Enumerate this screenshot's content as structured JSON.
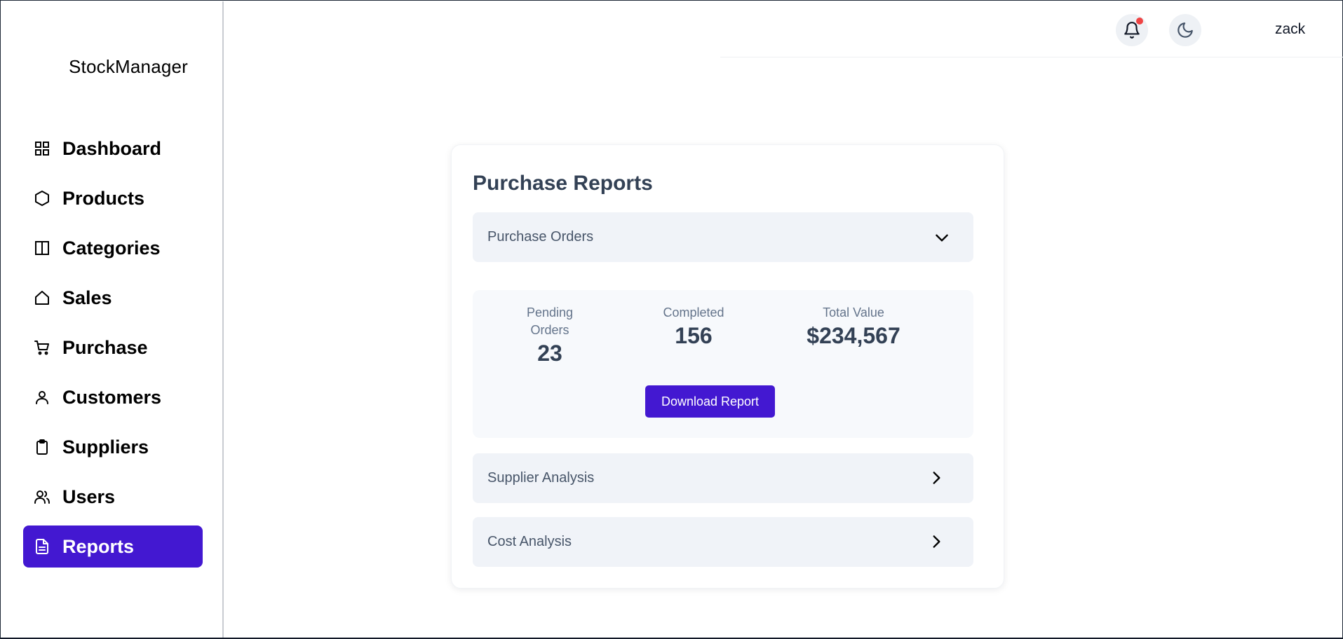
{
  "app": {
    "brand": "StockManager"
  },
  "sidebar": {
    "items": [
      {
        "label": "Dashboard",
        "icon": "grid-icon"
      },
      {
        "label": "Products",
        "icon": "hexagon-icon"
      },
      {
        "label": "Categories",
        "icon": "columns-icon"
      },
      {
        "label": "Sales",
        "icon": "home-icon"
      },
      {
        "label": "Purchase",
        "icon": "cart-icon"
      },
      {
        "label": "Customers",
        "icon": "user-icon"
      },
      {
        "label": "Suppliers",
        "icon": "clipboard-icon"
      },
      {
        "label": "Users",
        "icon": "users-icon"
      },
      {
        "label": "Reports",
        "icon": "file-text-icon",
        "active": true
      }
    ]
  },
  "topbar": {
    "notification_icon": "bell-icon",
    "theme_icon": "moon-icon",
    "username": "zack"
  },
  "report": {
    "title": "Purchase Reports",
    "sections": {
      "purchase_orders": {
        "label": "Purchase Orders",
        "expanded": true
      },
      "supplier_analysis": {
        "label": "Supplier Analysis",
        "expanded": false
      },
      "cost_analysis": {
        "label": "Cost Analysis",
        "expanded": false
      }
    },
    "stats": {
      "pending": {
        "label": "Pending Orders",
        "value": "23"
      },
      "completed": {
        "label": "Completed",
        "value": "156"
      },
      "total_value": {
        "label": "Total Value",
        "value": "$234,567"
      }
    },
    "download_label": "Download Report"
  },
  "colors": {
    "accent": "#4318d1",
    "notification_dot": "#ef4444",
    "accordion_bg": "#f0f3f8",
    "heading": "#334155"
  }
}
